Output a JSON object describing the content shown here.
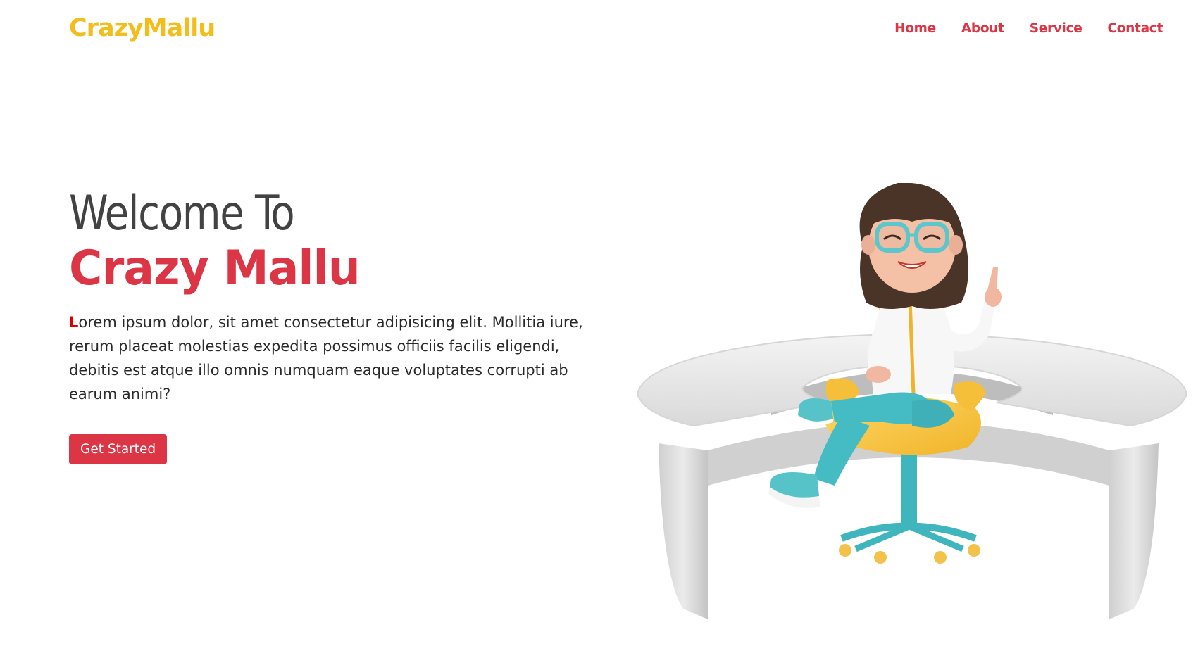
{
  "navbar": {
    "brand": "CrazyMallu",
    "links": [
      "Home",
      "About",
      "Service",
      "Contact"
    ]
  },
  "hero": {
    "heading_line1": "Welcome To",
    "heading_line2": "Crazy Mallu",
    "lead_first_letter": "L",
    "lead_rest": "orem ipsum dolor, sit amet consectetur adipisicing elit. Mollitia iure, rerum placeat molestias expedita possimus officiis facilis eligendi, debitis est atque illo omnis numquam eaque voluptates corrupti ab earum animi?",
    "cta_label": "Get Started"
  },
  "colors": {
    "brand": "#f3bd1c",
    "accent": "#dc3545"
  }
}
